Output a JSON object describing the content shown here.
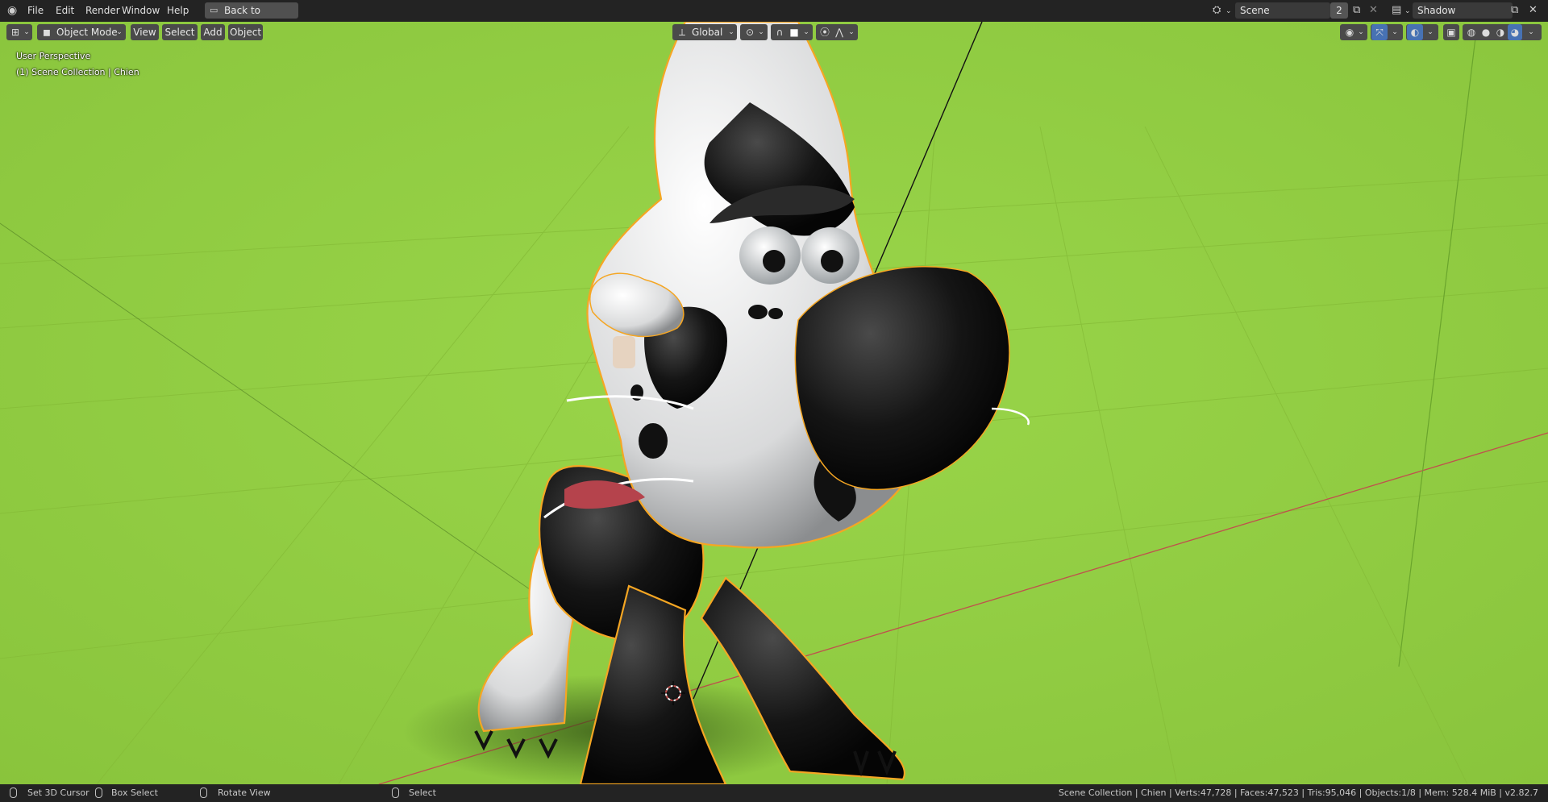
{
  "topbar": {
    "menus": [
      "File",
      "Edit",
      "Render",
      "Window",
      "Help"
    ],
    "back_button": "Back to Previous",
    "scene_name": "Scene",
    "scene_users": "2",
    "view_layer": "Shadow"
  },
  "header": {
    "mode": "Object Mode",
    "menus": [
      "View",
      "Select",
      "Add",
      "Object"
    ],
    "orientation": "Global"
  },
  "overlay": {
    "perspective": "User Perspective",
    "collection": "(1) Scene Collection | Chien"
  },
  "status": {
    "left_click": "Set 3D Cursor",
    "left_drag": "Box Select",
    "middle": "Rotate View",
    "right": "Select",
    "stats": "Scene Collection | Chien | Verts:47,728 | Faces:47,523 | Tris:95,046 | Objects:1/8 | Mem: 528.4 MiB | v2.82.7"
  },
  "colors": {
    "viewport_bg": "#94cf44",
    "selection_outline": "#f5a623",
    "topbar_bg": "#232323",
    "x_axis": "#c0504d"
  },
  "icons": [
    "blender-logo-icon",
    "back-icon",
    "scene-icon",
    "new-scene-icon",
    "close-icon",
    "view-layer-icon",
    "editor-type-icon",
    "object-mode-icon",
    "orientation-icon",
    "pivot-icon",
    "snap-icon",
    "proportional-edit-icon",
    "visibility-icon",
    "gizmo-icon",
    "overlay-icon",
    "xray-icon",
    "wireframe-shading-icon",
    "solid-shading-icon",
    "material-shading-icon",
    "rendered-shading-icon",
    "mouse-left-icon",
    "mouse-middle-icon",
    "mouse-right-icon"
  ]
}
